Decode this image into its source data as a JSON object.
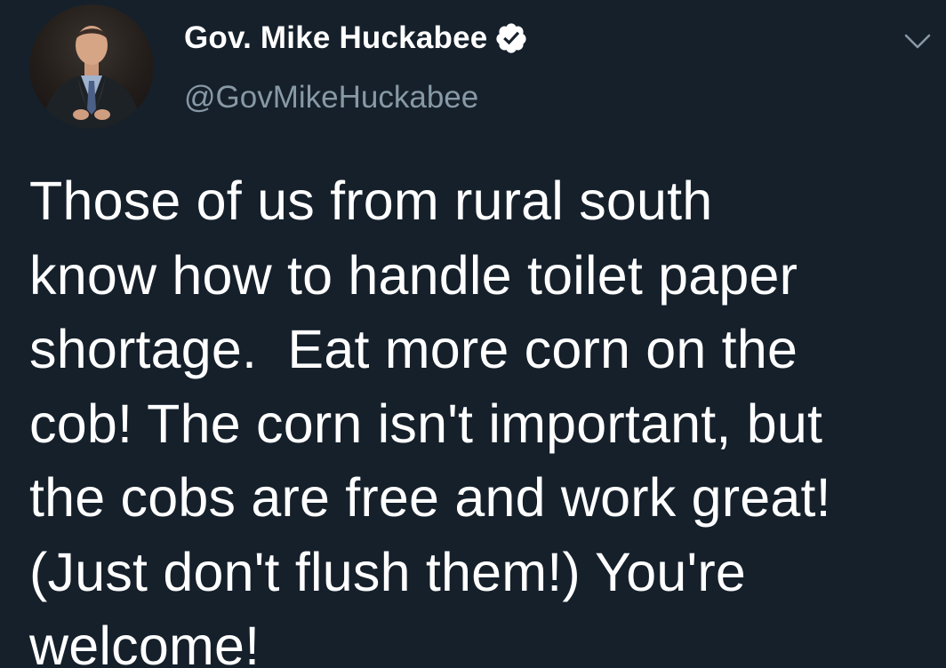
{
  "tweet": {
    "author": {
      "display_name": "Gov. Mike Huckabee",
      "handle": "@GovMikeHuckabee",
      "verified": true,
      "avatar_icon": "profile-photo"
    },
    "menu_icon": "chevron-down-icon",
    "text": "Those of us from rural south\nknow how to handle toilet paper\nshortage.  Eat more corn on the\ncob! The corn isn't important, but\nthe cobs are free and work great!\n(Just don't flush them!) You're\nwelcome!"
  },
  "colors": {
    "background": "#15202b",
    "name": "#ffffff",
    "handle": "#8899a6",
    "verified_badge": "#ffffff",
    "chevron": "#8899a6"
  }
}
